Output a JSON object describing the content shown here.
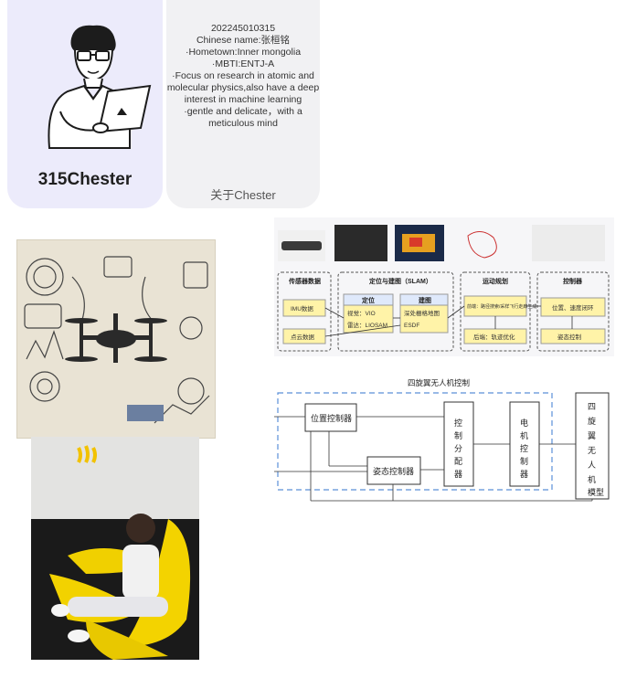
{
  "profile": {
    "name": "315Chester",
    "id": "202245010315",
    "chinese_name": "Chinese name:张桓铭",
    "hometown": "·Hometown:Inner mongolia",
    "mbti": "·MBTI:ENTJ-A",
    "focus": "·Focus on research in atomic and molecular physics,also have a deep interest in machine learning",
    "personality": "·gentle and delicate，with a meticulous mind",
    "about_label": "关于Chester"
  },
  "flow_diagram": {
    "sections": [
      "传感器数据",
      "定位与建图（SLAM）",
      "运动规划",
      "控制器"
    ],
    "sensors": [
      "IMU数据",
      "点云数据"
    ],
    "slam_loc_title": "定位",
    "slam_loc_items": [
      "视觉：VIO",
      "雷达：LIOSAM"
    ],
    "slam_map_title": "建图",
    "slam_map_items": [
      "深处栅格地图",
      "ESDF"
    ],
    "planning": [
      "前端：路径搜索/采样飞行走廊生成",
      "后端：轨迹优化"
    ],
    "control": [
      "位置、速度闭环",
      "姿态控制"
    ]
  },
  "control_diagram": {
    "title": "四旋翼无人机控制",
    "position_ctrl": "位置控制器",
    "attitude_ctrl": "姿态控制器",
    "allocator": "控制分配器",
    "motor_ctrl": "电机控制器",
    "model": "四旋翼无人机模型"
  },
  "colors": {
    "left_card": "#ecebfb",
    "right_card": "#f1f1f3",
    "yellow_box": "#fff3a8",
    "blue_box": "#dfe9fb",
    "dashed_blue": "#5a8fd8"
  }
}
